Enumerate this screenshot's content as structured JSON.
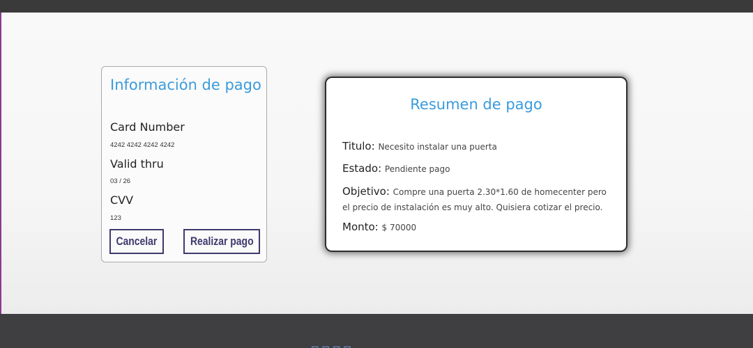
{
  "payment_info": {
    "title": "Información de pago",
    "card_number_label": "Card Number",
    "card_number_value": "4242 4242 4242 4242",
    "valid_thru_label": "Valid thru",
    "valid_thru_value": "03 / 26",
    "cvv_label": "CVV",
    "cvv_value": "123",
    "cancel_label": "Cancelar",
    "pay_label": "Realizar pago"
  },
  "summary": {
    "title": "Resumen de pago",
    "titulo_label": "Titulo:",
    "titulo_value": "Necesito instalar una puerta",
    "estado_label": "Estado:",
    "estado_value": "Pendiente pago",
    "objetivo_label": "Objetivo:",
    "objetivo_value": "Compre una puerta 2.30*1.60 de homecenter pero el precio de instalación es muy alto. Quisiera cotizar el precio.",
    "monto_label": "Monto:",
    "monto_value": "$ 70000"
  },
  "colors": {
    "accent": "#3a9bdc",
    "button": "#3e3a6e",
    "footer": "#3f3e40",
    "top_bar": "#3a3a3a"
  }
}
